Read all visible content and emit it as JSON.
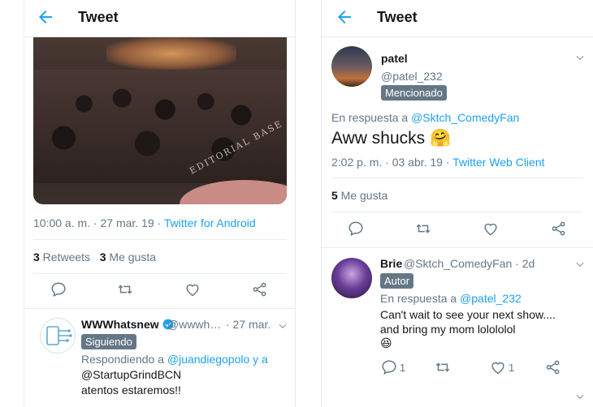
{
  "left": {
    "header": {
      "title": "Tweet"
    },
    "photo": {
      "watermark": "EDITORIAL BASE"
    },
    "meta": {
      "time_date": "10:00 a. m. · 27 mar. 19 · ",
      "source": "Twitter for Android"
    },
    "counts": {
      "retweets_num": "3",
      "retweets_label": " Retweets",
      "likes_num": "3",
      "likes_label": " Me gusta"
    },
    "reply": {
      "name": "WWWhatsnew",
      "handle": "@wwwh…",
      "date": "· 27 mar.",
      "badge": "Siguiendo",
      "replying_prefix": "Respondiendo a ",
      "replying_users_1": "@juandiegopolo y a",
      "replying_users_2": "@StartupGrindBCN",
      "text": "atentos estaremos!!"
    }
  },
  "right": {
    "header": {
      "title": "Tweet"
    },
    "tweet": {
      "name": "patel",
      "handle": "@patel_232",
      "badge": "Mencionado",
      "reply_prefix": "En respuesta a ",
      "reply_user": "@Sktch_ComedyFan",
      "text": "Aww shucks 🤗",
      "time_date": "2:02 p. m. · 03 abr. 19 · ",
      "source": "Twitter Web Client",
      "likes_num": "5",
      "likes_label": " Me gusta"
    },
    "reply": {
      "name": "Brie",
      "handle": "@Sktch_ComedyFan · 2d",
      "badge": "Autor",
      "reply_prefix": "En respuesta a ",
      "reply_user": "@patel_232",
      "line1": "Can't wait to see your next show....",
      "line2": "and bring my mom lolololol",
      "emoji": "😆",
      "reply_count": "1",
      "like_count": "1"
    }
  },
  "colors": {
    "accent": "#1da1f2",
    "muted": "#657786",
    "verified": "#1da1f2",
    "divider": "#e6ecf0"
  },
  "icons": [
    "back-arrow-icon",
    "reply-icon",
    "retweet-icon",
    "like-icon",
    "share-icon",
    "chevron-down-icon",
    "verified-icon"
  ]
}
